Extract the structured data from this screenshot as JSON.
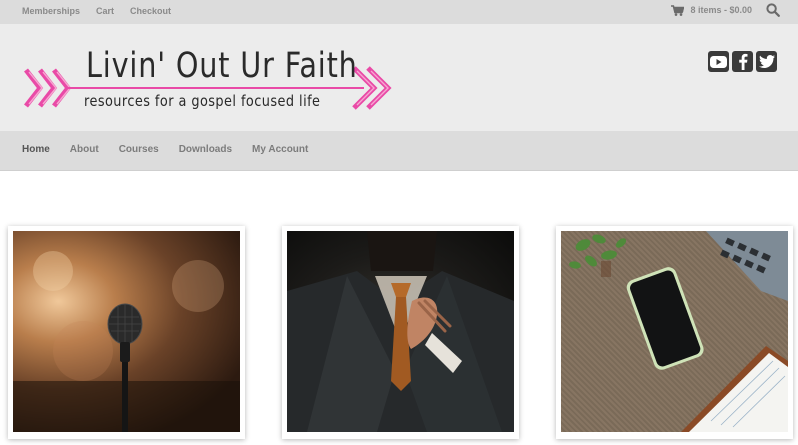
{
  "topbar": {
    "links": [
      "Memberships",
      "Cart",
      "Checkout"
    ],
    "cart_text": "8 items - $0.00",
    "cart_icon": "shopping-cart-icon",
    "search_icon": "search-icon"
  },
  "header": {
    "logo_title": "Livin' Out Ur Faith",
    "logo_tagline": "resources for a gospel focused life",
    "accent_color": "#e94aa7",
    "social_icons": [
      "youtube-icon",
      "facebook-icon",
      "twitter-icon"
    ]
  },
  "nav": {
    "items": [
      "Home",
      "About",
      "Courses",
      "Downloads",
      "My Account"
    ],
    "active": "Home"
  },
  "cards": [
    {
      "image": "microphone-photo"
    },
    {
      "image": "man-adjusting-tie-photo"
    },
    {
      "image": "desk-phone-laptop-photo"
    }
  ]
}
